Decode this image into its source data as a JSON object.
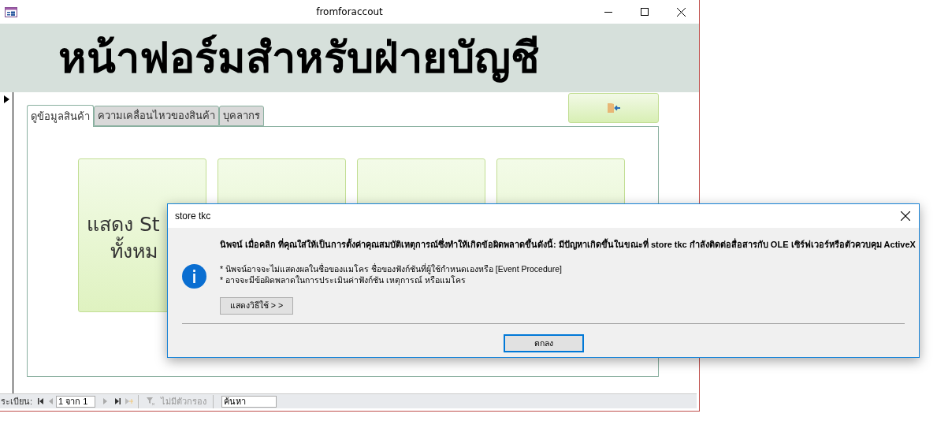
{
  "window": {
    "title": "fromforaccout"
  },
  "header": {
    "title": "หน้าฟอร์มสำหรับฝ่ายบัญชี"
  },
  "tabs": [
    {
      "label": "ดูข้อมูลสินค้า",
      "selected": true
    },
    {
      "label": "ความเคลื่อนไหวของสินค้า",
      "selected": false
    },
    {
      "label": "บุคลากร",
      "selected": false
    }
  ],
  "first_tile": {
    "lines": [
      "แสดง St",
      "ทั้งหม"
    ]
  },
  "navigation": {
    "label": "ระเบียน:",
    "position": "1 จาก 1",
    "filter": "ไม่มีตัวกรอง",
    "search_placeholder": "ค้นหา"
  },
  "dialog": {
    "title": "store tkc",
    "message": "นิพจน์ เมื่อคลิก ที่คุณใส่ให้เป็นการตั้งค่าคุณสมบัติเหตุการณ์ซึ่งทำให้เกิดข้อผิดพลาดขึ้นดังนี้: มีปัญหาเกิดขึ้นในขณะที่ store tkc กำลังติดต่อสื่อสารกับ OLE เซิร์ฟเวอร์หรือตัวควบคุม ActiveX",
    "notes": [
      "* นิพจน์อาจจะไม่แสดงผลในชื่อของแมโคร ชื่อของฟังก์ชันที่ผู้ใช้กำหนดเองหรือ [Event Procedure]",
      "* อาจจะมีข้อผิดพลาดในการประเมินค่าฟังก์ชัน เหตุการณ์ หรือแมโคร"
    ],
    "details_button": "แสดงวิธีใช้ > >",
    "ok_button": "ตกลง"
  }
}
